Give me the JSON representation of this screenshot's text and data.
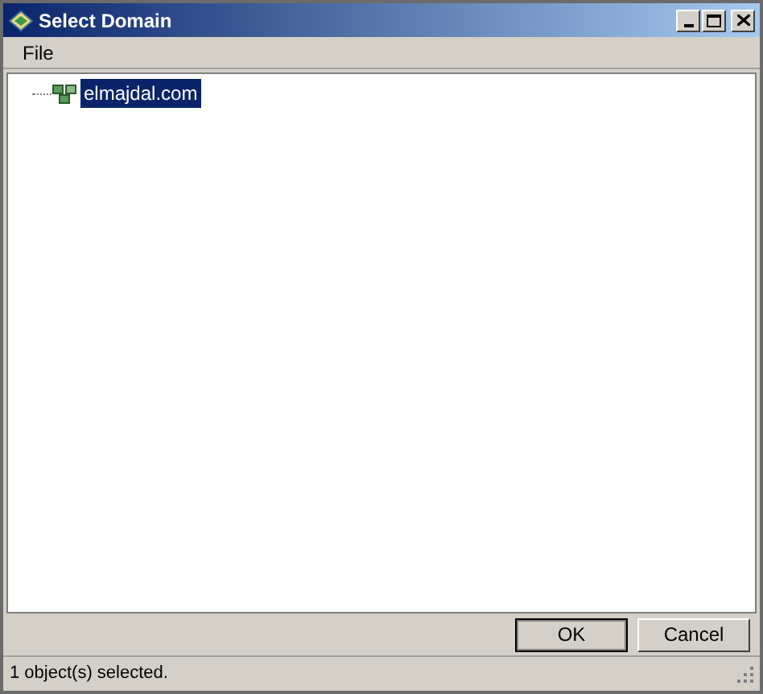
{
  "window": {
    "title": "Select Domain"
  },
  "menu": [
    "File"
  ],
  "tree": [
    {
      "label": "elmajdal.com",
      "selected": true
    }
  ],
  "buttons": [
    {
      "label": "OK",
      "default": true
    },
    {
      "label": "Cancel",
      "default": false
    }
  ],
  "status_bar": "1 object(s) selected."
}
